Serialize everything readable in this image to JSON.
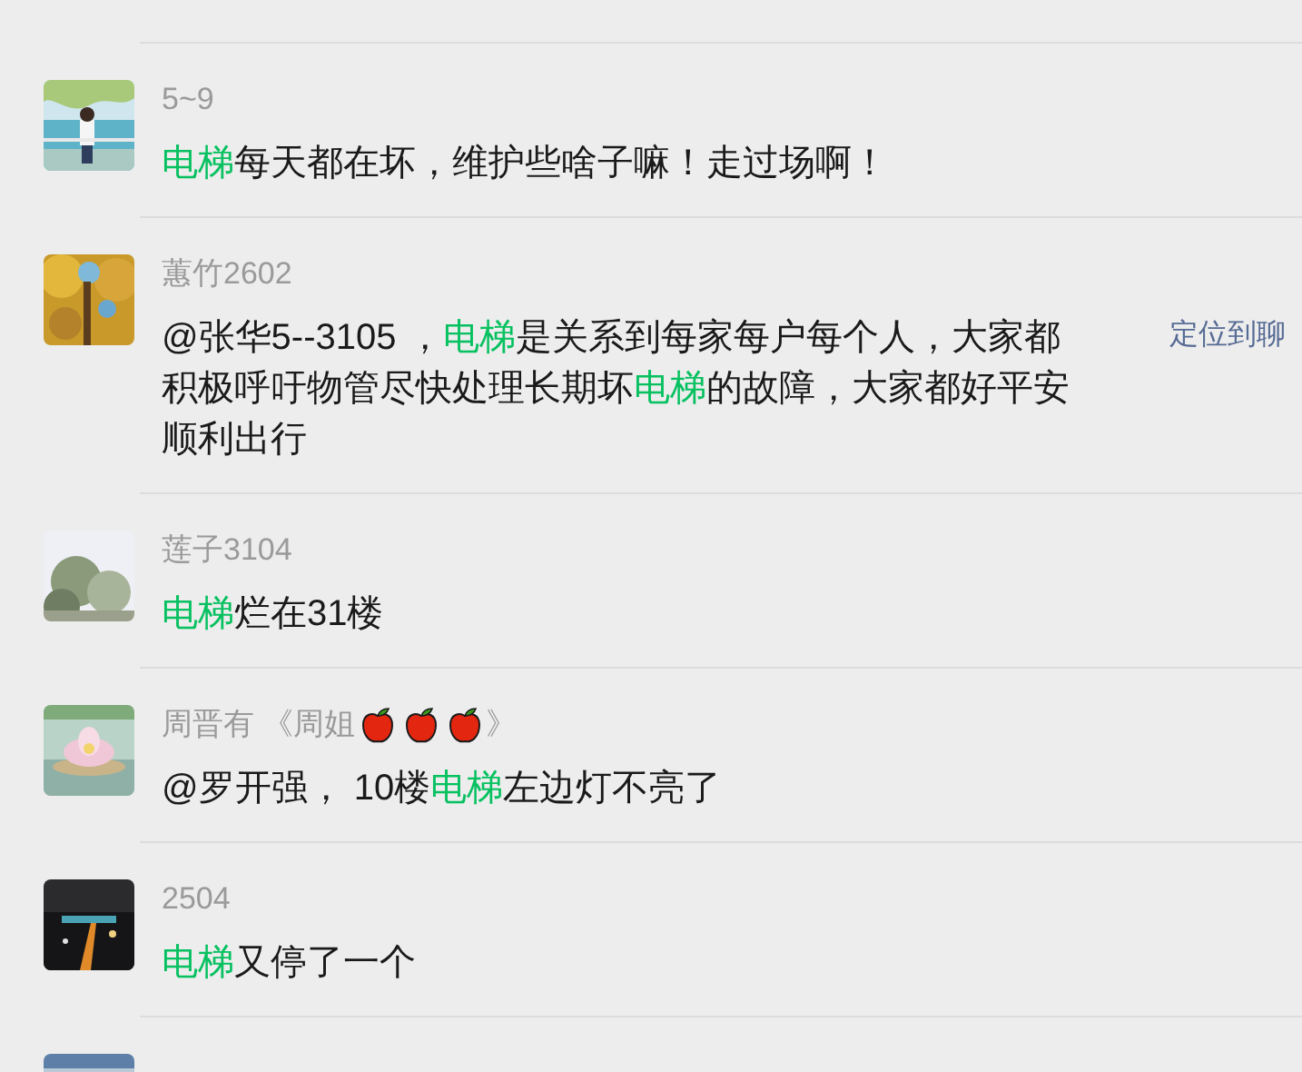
{
  "results": [
    {
      "avatar": {
        "kind": "picture"
      },
      "name": [
        {
          "kind": "text",
          "text": "5~9"
        }
      ],
      "message": [
        [
          {
            "text": "电梯",
            "highlight": true
          },
          {
            "text": "每天都在坏，维护些啥子嘛！走过场啊！",
            "highlight": false
          }
        ]
      ]
    },
    {
      "avatar": {
        "kind": "picture"
      },
      "name": [
        {
          "kind": "text",
          "text": "蕙竹2602"
        }
      ],
      "message": [
        [
          {
            "text": "@张华5--3105 ，",
            "highlight": false
          },
          {
            "text": "电梯",
            "highlight": true
          },
          {
            "text": "是关系到每家每户每个人，大家都",
            "highlight": false
          }
        ],
        [
          {
            "text": "积极呼吁物管尽快处理长期坏",
            "highlight": false
          },
          {
            "text": "电梯",
            "highlight": true
          },
          {
            "text": "的故障，大家都好平安",
            "highlight": false
          }
        ],
        [
          {
            "text": "顺利出行",
            "highlight": false
          }
        ]
      ],
      "action": "定位到聊"
    },
    {
      "avatar": {
        "kind": "picture"
      },
      "name": [
        {
          "kind": "text",
          "text": "莲子3104"
        }
      ],
      "message": [
        [
          {
            "text": "电梯",
            "highlight": true
          },
          {
            "text": "烂在31楼",
            "highlight": false
          }
        ]
      ]
    },
    {
      "avatar": {
        "kind": "picture"
      },
      "name": [
        {
          "kind": "text",
          "text": "周晋有 《周姐"
        },
        {
          "kind": "apple"
        },
        {
          "kind": "apple"
        },
        {
          "kind": "apple"
        },
        {
          "kind": "text",
          "text": "》"
        }
      ],
      "message": [
        [
          {
            "text": "@罗开强， 10楼",
            "highlight": false
          },
          {
            "text": "电梯",
            "highlight": true
          },
          {
            "text": "左边灯不亮了",
            "highlight": false
          }
        ]
      ]
    },
    {
      "avatar": {
        "kind": "picture"
      },
      "name": [
        {
          "kind": "text",
          "text": "2504"
        }
      ],
      "message": [
        [
          {
            "text": "电梯",
            "highlight": true
          },
          {
            "text": "又停了一个",
            "highlight": false
          }
        ]
      ]
    },
    {
      "avatar": {
        "kind": "picture"
      }
    }
  ]
}
